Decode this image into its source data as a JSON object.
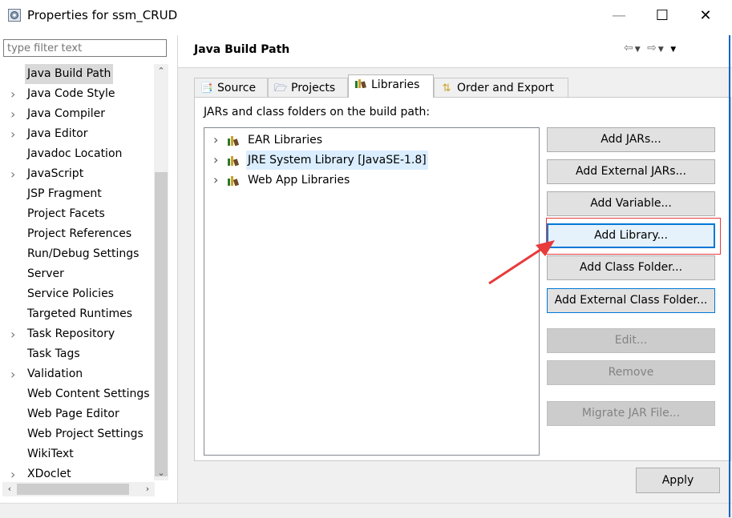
{
  "window": {
    "title": "Properties for ssm_CRUD",
    "icon": "gear-app-icon",
    "minimize": "—",
    "maximize": "☐",
    "close": "✕"
  },
  "left": {
    "filter_placeholder": "type filter text",
    "items": [
      {
        "label": "Java Build Path",
        "expandable": false,
        "selected": true
      },
      {
        "label": "Java Code Style",
        "expandable": true
      },
      {
        "label": "Java Compiler",
        "expandable": true
      },
      {
        "label": "Java Editor",
        "expandable": true
      },
      {
        "label": "Javadoc Location",
        "expandable": false
      },
      {
        "label": "JavaScript",
        "expandable": true
      },
      {
        "label": "JSP Fragment",
        "expandable": false
      },
      {
        "label": "Project Facets",
        "expandable": false
      },
      {
        "label": "Project References",
        "expandable": false
      },
      {
        "label": "Run/Debug Settings",
        "expandable": false
      },
      {
        "label": "Server",
        "expandable": false
      },
      {
        "label": "Service Policies",
        "expandable": false
      },
      {
        "label": "Targeted Runtimes",
        "expandable": false
      },
      {
        "label": "Task Repository",
        "expandable": true
      },
      {
        "label": "Task Tags",
        "expandable": false
      },
      {
        "label": "Validation",
        "expandable": true
      },
      {
        "label": "Web Content Settings",
        "expandable": false
      },
      {
        "label": "Web Page Editor",
        "expandable": false
      },
      {
        "label": "Web Project Settings",
        "expandable": false
      },
      {
        "label": "WikiText",
        "expandable": false
      },
      {
        "label": "XDoclet",
        "expandable": true
      }
    ]
  },
  "page": {
    "title": "Java Build Path",
    "tabs": [
      {
        "label": "Source",
        "icon": "source-folder-icon"
      },
      {
        "label": "Projects",
        "icon": "projects-folder-icon"
      },
      {
        "label": "Libraries",
        "icon": "libraries-icon",
        "active": true
      },
      {
        "label": "Order and Export",
        "icon": "order-export-icon"
      }
    ],
    "list_label": "JARs and class folders on the build path:",
    "libraries": [
      {
        "label": "EAR Libraries"
      },
      {
        "label": "JRE System Library [JavaSE-1.8]",
        "highlighted": true
      },
      {
        "label": "Web App Libraries"
      }
    ],
    "buttons": [
      {
        "label": "Add JARs...",
        "enabled": true
      },
      {
        "label": "Add External JARs...",
        "enabled": true
      },
      {
        "label": "Add Variable...",
        "enabled": true
      },
      {
        "label": "Add Library...",
        "enabled": true,
        "focused": true
      },
      {
        "label": "Add Class Folder...",
        "enabled": true
      },
      {
        "label": "Add External Class Folder...",
        "enabled": true
      },
      {
        "label": "Edit...",
        "enabled": false
      },
      {
        "label": "Remove",
        "enabled": false
      },
      {
        "label": "Migrate JAR File...",
        "enabled": false
      }
    ],
    "apply_label": "Apply"
  },
  "colors": {
    "accent": "#0078d7",
    "annotation": "#e83b3b"
  }
}
